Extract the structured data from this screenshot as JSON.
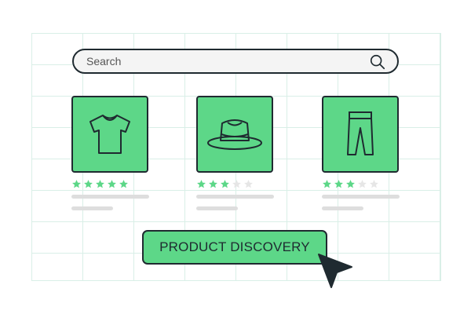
{
  "search": {
    "placeholder": "Search",
    "icon": "search-icon"
  },
  "products": [
    {
      "icon": "t-shirt-icon",
      "rating": 5,
      "max_rating": 5
    },
    {
      "icon": "hat-icon",
      "rating": 3,
      "max_rating": 5
    },
    {
      "icon": "pants-icon",
      "rating": 3,
      "max_rating": 5
    }
  ],
  "cta": {
    "label": "PRODUCT DISCOVERY"
  },
  "colors": {
    "accent": "#5dd788",
    "outline": "#1f2a30",
    "star_filled": "#5dd788",
    "star_empty": "#e6e6e6",
    "grid": "#d9efe7",
    "placeholder_line": "#dedede"
  }
}
